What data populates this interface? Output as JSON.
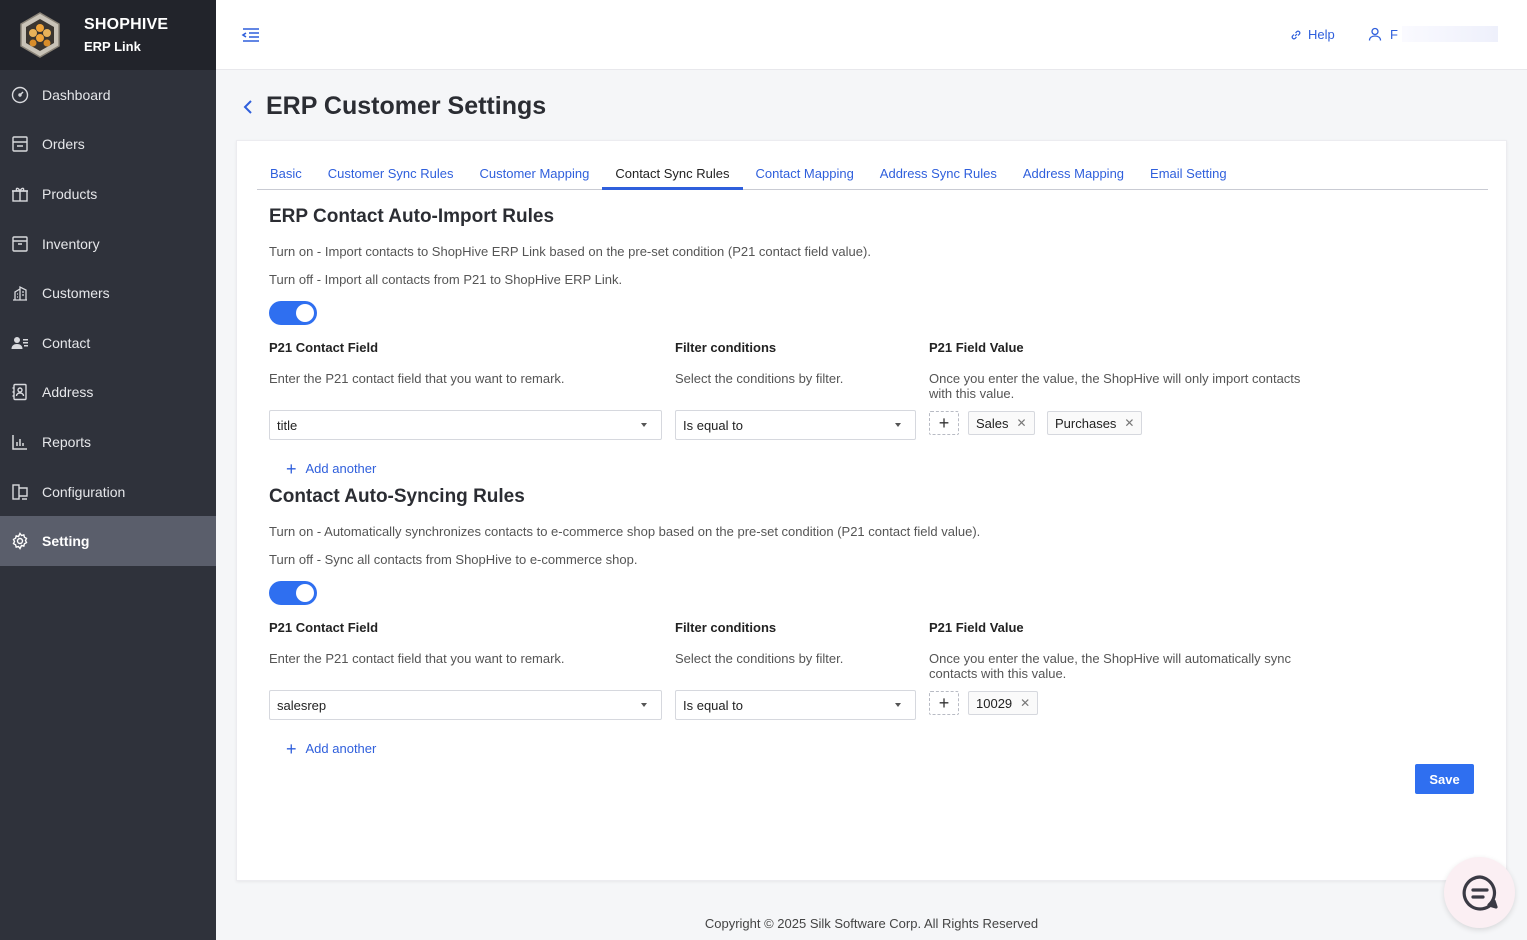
{
  "brand": {
    "name": "SHOPHIVE",
    "subtitle": "ERP Link"
  },
  "sidebar": {
    "items": [
      {
        "label": "Dashboard",
        "icon": "gauge-icon"
      },
      {
        "label": "Orders",
        "icon": "orders-icon"
      },
      {
        "label": "Products",
        "icon": "gift-icon"
      },
      {
        "label": "Inventory",
        "icon": "archive-icon"
      },
      {
        "label": "Customers",
        "icon": "building-icon"
      },
      {
        "label": "Contact",
        "icon": "contact-icon"
      },
      {
        "label": "Address",
        "icon": "address-book-icon"
      },
      {
        "label": "Reports",
        "icon": "bar-chart-icon"
      },
      {
        "label": "Configuration",
        "icon": "config-icon"
      },
      {
        "label": "Setting",
        "icon": "gear-icon",
        "active": true
      }
    ]
  },
  "topbar": {
    "help_label": "Help",
    "user_initial": "F"
  },
  "page": {
    "title": "ERP Customer Settings"
  },
  "tabs": [
    {
      "label": "Basic"
    },
    {
      "label": "Customer Sync Rules"
    },
    {
      "label": "Customer Mapping"
    },
    {
      "label": "Contact Sync Rules",
      "active": true
    },
    {
      "label": "Contact Mapping"
    },
    {
      "label": "Address Sync Rules"
    },
    {
      "label": "Address Mapping"
    },
    {
      "label": "Email Setting"
    }
  ],
  "import_rules": {
    "title": "ERP Contact Auto-Import Rules",
    "turn_on": "Turn on - Import contacts to ShopHive ERP Link based on the pre-set condition (P21 contact field value).",
    "turn_off": "Turn off - Import all contacts from P21 to ShopHive ERP Link.",
    "enabled": true,
    "field_head": "P21 Contact Field",
    "field_desc": "Enter the P21 contact field that you want to remark.",
    "filter_head": "Filter conditions",
    "filter_desc": "Select the conditions by filter.",
    "value_head": "P21 Field Value",
    "value_desc_1": "Once you enter the value, the ShopHive will only import contacts",
    "value_desc_2": "with this value.",
    "field_value": "title",
    "filter_value": "Is equal to",
    "tags": [
      "Sales",
      "Purchases"
    ],
    "add_another": "Add another"
  },
  "sync_rules": {
    "title": "Contact Auto-Syncing Rules",
    "turn_on": "Turn on - Automatically synchronizes contacts to e-commerce shop based on the pre-set condition (P21 contact field value).",
    "turn_off": "Turn off - Sync all contacts from ShopHive to e-commerce shop.",
    "enabled": true,
    "field_head": "P21 Contact Field",
    "field_desc": "Enter the P21 contact field that you want to remark.",
    "filter_head": "Filter conditions",
    "filter_desc": "Select the conditions by filter.",
    "value_head": "P21 Field Value",
    "value_desc_1": "Once you enter the value, the ShopHive will automatically sync",
    "value_desc_2": "contacts with this value.",
    "field_value": "salesrep",
    "filter_value": "Is equal to",
    "tags": [
      "10029"
    ],
    "add_another": "Add another"
  },
  "save_label": "Save",
  "footer": "Copyright © 2025 Silk Software Corp. All Rights Reserved"
}
